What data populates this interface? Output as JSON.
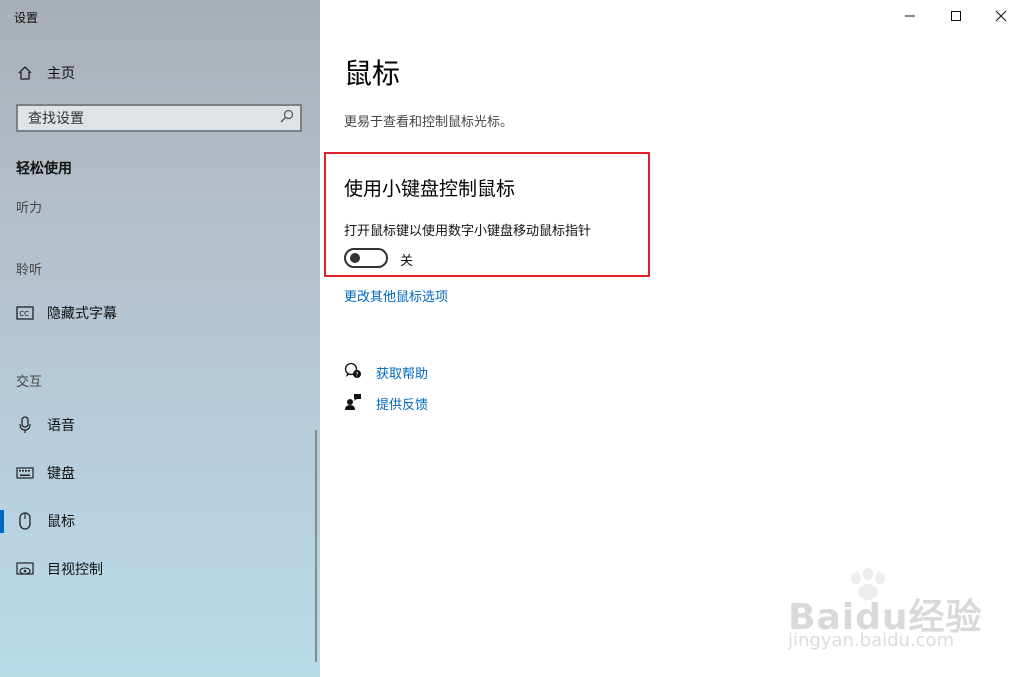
{
  "window": {
    "app_title": "设置",
    "minimize_icon": "minimize-icon",
    "maximize_icon": "maximize-icon",
    "close_icon": "close-icon"
  },
  "sidebar": {
    "home_label": "主页",
    "search_placeholder": "查找设置",
    "section_title": "轻松使用",
    "groups": {
      "hearing_partial": "听力",
      "listening": "聆听",
      "interaction": "交互"
    },
    "items": [
      {
        "label": "隐藏式字幕",
        "icon": "closed-caption-icon"
      },
      {
        "label": "语音",
        "icon": "microphone-icon"
      },
      {
        "label": "键盘",
        "icon": "keyboard-icon"
      },
      {
        "label": "鼠标",
        "icon": "mouse-icon",
        "selected": true
      },
      {
        "label": "目视控制",
        "icon": "eye-control-icon"
      }
    ]
  },
  "main": {
    "title": "鼠标",
    "subtitle": "更易于查看和控制鼠标光标。",
    "section_heading": "使用小键盘控制鼠标",
    "setting_description": "打开鼠标键以使用数字小键盘移动鼠标指针",
    "toggle_state": "关",
    "toggle_on": false,
    "link_more_options": "更改其他鼠标选项",
    "help_link": "获取帮助",
    "feedback_link": "提供反馈"
  },
  "watermark": {
    "brand": "Baidu经验",
    "url": "jingyan.baidu.com"
  },
  "colors": {
    "accent": "#0067c0",
    "highlight_border": "#e0222b"
  }
}
